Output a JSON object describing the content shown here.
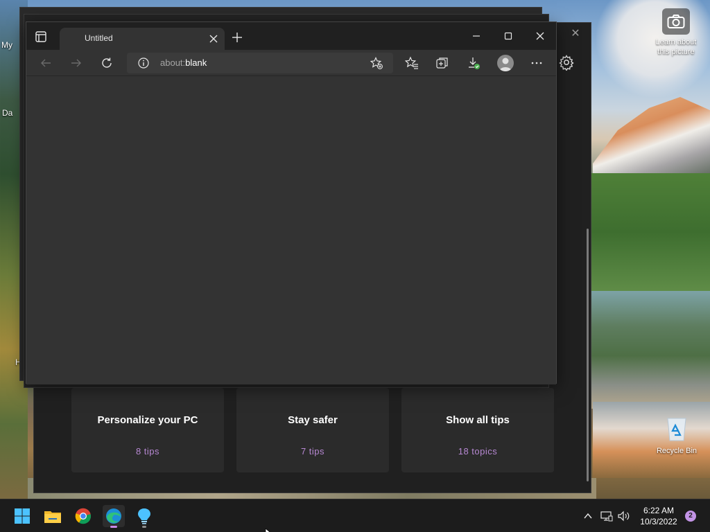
{
  "desktop": {
    "lap_label": "Learn about this picture",
    "recycle_label": "Recycle Bin",
    "left_frag_1": "My",
    "left_frag_2": "Da",
    "left_frag_3": "H"
  },
  "tips_app": {
    "cards": [
      {
        "title": "Personalize your PC",
        "subtitle": "8 tips"
      },
      {
        "title": "Stay safer",
        "subtitle": "7 tips"
      },
      {
        "title": "Show all tips",
        "subtitle": "18 topics"
      }
    ]
  },
  "browser": {
    "tab_title": "Untitled",
    "url_scheme": "about:",
    "url_path": "blank"
  },
  "taskbar": {
    "time": "6:22 AM",
    "date": "10/3/2022",
    "notifications": "2"
  },
  "colors": {
    "accent": "#c989e8",
    "tip_link": "#b889d4"
  }
}
